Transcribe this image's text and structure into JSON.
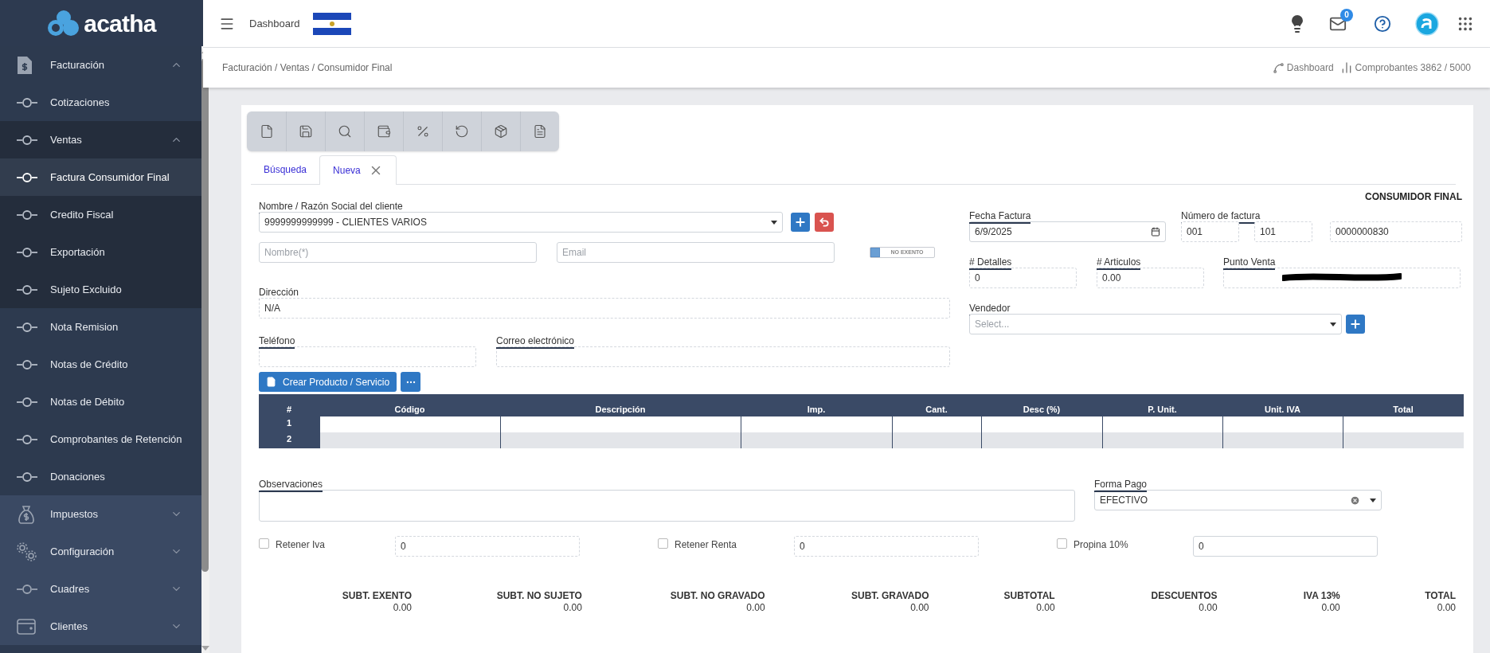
{
  "sidebar": {
    "logo": "acatha",
    "items": [
      {
        "label": "Facturación",
        "expanded": true,
        "selected": false,
        "children": [
          {
            "label": "Cotizaciones",
            "selected": false
          },
          {
            "label": "Ventas",
            "expanded": true,
            "selected": false,
            "children": [
              {
                "label": "Factura Consumidor Final",
                "selected": true
              },
              {
                "label": "Credito Fiscal",
                "selected": false
              },
              {
                "label": "Exportación",
                "selected": false
              },
              {
                "label": "Sujeto Excluido",
                "selected": false
              }
            ]
          },
          {
            "label": "Nota Remision",
            "selected": false
          },
          {
            "label": "Notas de Crédito",
            "selected": false
          },
          {
            "label": "Notas de Débito",
            "selected": false
          },
          {
            "label": "Comprobantes de Retención",
            "selected": false
          },
          {
            "label": "Donaciones",
            "selected": false
          }
        ]
      },
      {
        "label": "Impuestos",
        "expanded": false,
        "selected": false
      },
      {
        "label": "Configuración",
        "expanded": false,
        "selected": false
      },
      {
        "label": "Cuadres",
        "expanded": false,
        "selected": false
      },
      {
        "label": "Clientes",
        "expanded": false,
        "selected": false
      }
    ]
  },
  "header": {
    "title": "Dashboard",
    "mail_badge": "0"
  },
  "breadcrumb": {
    "path": "Facturación / Ventas / Consumidor Final",
    "dashboard_link": "Dashboard",
    "quota": "Comprobantes 3862 / 5000"
  },
  "tabs": [
    {
      "label": "Búsqueda",
      "selected": false
    },
    {
      "label": "Nueva",
      "selected": true
    }
  ],
  "form": {
    "doc_type": "CONSUMIDOR FINAL",
    "client": {
      "label": "Nombre / Razón Social del cliente",
      "value": "9999999999999 - CLIENTES VARIOS"
    },
    "name_field": {
      "placeholder": "Nombre(*)"
    },
    "email_field": {
      "placeholder": "Email"
    },
    "exento_toggle": {
      "label": "NO EXENTO",
      "on": false
    },
    "direccion": {
      "label": "Dirección",
      "value": "N/A"
    },
    "telefono": {
      "label": "Teléfono"
    },
    "correo": {
      "label": "Correo electrónico"
    },
    "fecha": {
      "label": "Fecha Factura",
      "value": "6/9/2025"
    },
    "numero": {
      "label": "Número de factura",
      "parts": [
        "001",
        "101",
        "0000000830"
      ]
    },
    "detalles": {
      "label": "# Detalles",
      "value": "0"
    },
    "articulos": {
      "label": "# Articulos",
      "value": "0.00"
    },
    "punto_venta": {
      "label": "Punto Venta"
    },
    "vendedor": {
      "label": "Vendedor",
      "placeholder": "Select..."
    }
  },
  "create_button": "Crear Producto / Servicio",
  "table": {
    "columns": [
      "#",
      "Código",
      "Descripción",
      "Imp.",
      "Cant.",
      "Desc (%)",
      "P. Unit.",
      "Unit. IVA",
      "Total"
    ],
    "rows": [
      {
        "number": "1"
      },
      {
        "number": "2"
      }
    ]
  },
  "observaciones": {
    "label": "Observaciones"
  },
  "forma_pago": {
    "label": "Forma Pago",
    "value": "EFECTIVO"
  },
  "retenciones": [
    {
      "label": "Retener Iva",
      "checked": false,
      "value": "0"
    },
    {
      "label": "Retener Renta",
      "checked": false,
      "value": "0"
    },
    {
      "label": "Propina 10%",
      "checked": false,
      "value": "0"
    }
  ],
  "totals": [
    {
      "label": "SUBT. EXENTO",
      "value": "0.00"
    },
    {
      "label": "SUBT. NO SUJETO",
      "value": "0.00"
    },
    {
      "label": "SUBT. NO GRAVADO",
      "value": "0.00"
    },
    {
      "label": "SUBT. GRAVADO",
      "value": "0.00"
    },
    {
      "label": "SUBTOTAL",
      "value": "0.00"
    },
    {
      "label": "DESCUENTOS",
      "value": "0.00"
    },
    {
      "label": "IVA 13%",
      "value": "0.00"
    },
    {
      "label": "TOTAL",
      "value": "0.00"
    }
  ]
}
